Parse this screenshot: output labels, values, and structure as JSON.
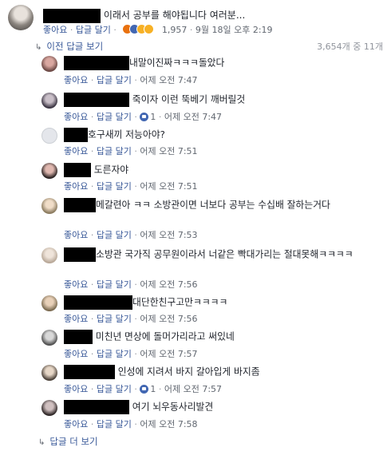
{
  "main_comment": {
    "text": "이래서 공부를 해야됩니다 여러분...",
    "like": "좋아요",
    "reply": "답글 달기",
    "reaction_count": "1,957",
    "time": "9월 18일 오후 2:19"
  },
  "replies_bar": {
    "previous_label": "이전 답글 보기",
    "count": "3,654개 중 11개"
  },
  "replies": [
    {
      "text": "내말이진짜ㅋㅋㅋ돌았다",
      "time": "어제 오전 7:47",
      "likes": ""
    },
    {
      "text": "죽이자 이런 뚝베기 깨버릴것",
      "time": "어제 오전 7:47",
      "likes": "1"
    },
    {
      "text": "호구새끼 저능아야?",
      "time": "어제 오전 7:51",
      "likes": ""
    },
    {
      "text": "도른자야",
      "time": "어제 오전 7:51",
      "likes": ""
    },
    {
      "text": "메갈련아 ㅋㅋ 소방관이면 너보다 공부는 수십배 잘하는거다",
      "time": "어제 오전 7:53",
      "likes": ""
    },
    {
      "text": "소방관 국가직 공무원이라서 너같은 빡대가리는 절대못해ㅋㅋㅋㅋ",
      "time": "어제 오전 7:56",
      "likes": ""
    },
    {
      "text": "대단한친구고만ㅋㅋㅋㅋ",
      "time": "어제 오전 7:56",
      "likes": ""
    },
    {
      "text": "미친년 면상에 돌머가리라고 써있네",
      "time": "어제 오전 7:57",
      "likes": ""
    },
    {
      "text": "인성에 지려서 바지 갈아입게 바지좀",
      "time": "어제 오전 7:57",
      "likes": "1"
    },
    {
      "text": "여기 뇌우동사리발견",
      "time": "어제 오전 7:58",
      "likes": ""
    }
  ],
  "reply_actions": {
    "like": "좋아요",
    "reply": "답글 달기"
  },
  "more_replies": "답글 더 보기",
  "colors": {
    "link": "#385898",
    "meta": "#616770",
    "like_blue": "#4267b2"
  }
}
